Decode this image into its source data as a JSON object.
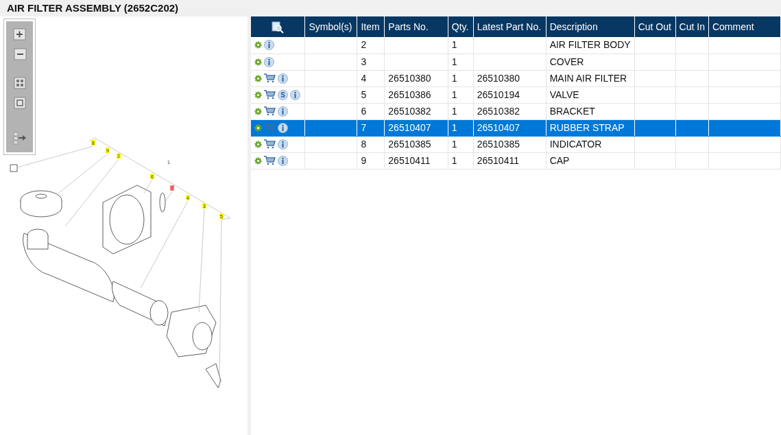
{
  "title": "AIR FILTER ASSEMBLY (2652C202)",
  "diagram": {
    "callouts": [
      {
        "label": "8",
        "kind": "tag",
        "selected": false
      },
      {
        "label": "9",
        "kind": "tag",
        "selected": false
      },
      {
        "label": "2",
        "kind": "tag",
        "selected": false
      },
      {
        "label": "1",
        "kind": "plain",
        "selected": false
      },
      {
        "label": "6",
        "kind": "tag",
        "selected": false
      },
      {
        "label": "7",
        "kind": "tag",
        "selected": true
      },
      {
        "label": "4",
        "kind": "tag",
        "selected": false
      },
      {
        "label": "3",
        "kind": "tag",
        "selected": false
      },
      {
        "label": "5",
        "kind": "tag",
        "selected": false
      }
    ]
  },
  "table": {
    "columns": [
      "Symbol(s)",
      "Item",
      "Parts No.",
      "Qty.",
      "Latest Part No.",
      "Description",
      "Cut Out",
      "Cut In",
      "Comment"
    ],
    "rows": [
      {
        "icons": [
          {
            "kind": "gear"
          },
          {
            "kind": "info"
          }
        ],
        "cells": [
          "",
          "2",
          "",
          "1",
          "",
          "AIR FILTER BODY",
          "",
          "",
          ""
        ],
        "selected": false
      },
      {
        "icons": [
          {
            "kind": "gear"
          },
          {
            "kind": "info"
          }
        ],
        "cells": [
          "",
          "3",
          "",
          "1",
          "",
          "COVER",
          "",
          "",
          ""
        ],
        "selected": false
      },
      {
        "icons": [
          {
            "kind": "gear"
          },
          {
            "kind": "cart"
          },
          {
            "kind": "info"
          }
        ],
        "cells": [
          "",
          "4",
          "26510380",
          "1",
          "26510380",
          "MAIN AIR FILTER",
          "",
          "",
          ""
        ],
        "selected": false
      },
      {
        "icons": [
          {
            "kind": "gear"
          },
          {
            "kind": "cart"
          },
          {
            "kind": "letter",
            "text": "S"
          },
          {
            "kind": "info"
          }
        ],
        "cells": [
          "",
          "5",
          "26510386",
          "1",
          "26510194",
          "VALVE",
          "",
          "",
          ""
        ],
        "selected": false
      },
      {
        "icons": [
          {
            "kind": "gear"
          },
          {
            "kind": "cart"
          },
          {
            "kind": "info"
          }
        ],
        "cells": [
          "",
          "6",
          "26510382",
          "1",
          "26510382",
          "BRACKET",
          "",
          "",
          ""
        ],
        "selected": false
      },
      {
        "icons": [
          {
            "kind": "gear"
          },
          {
            "kind": "cart"
          },
          {
            "kind": "info"
          }
        ],
        "cells": [
          "",
          "7",
          "26510407",
          "1",
          "26510407",
          "RUBBER STRAP",
          "",
          "",
          ""
        ],
        "selected": true
      },
      {
        "icons": [
          {
            "kind": "gear"
          },
          {
            "kind": "cart"
          },
          {
            "kind": "info"
          }
        ],
        "cells": [
          "",
          "8",
          "26510385",
          "1",
          "26510385",
          "INDICATOR",
          "",
          "",
          ""
        ],
        "selected": false
      },
      {
        "icons": [
          {
            "kind": "gear"
          },
          {
            "kind": "cart"
          },
          {
            "kind": "info"
          }
        ],
        "cells": [
          "",
          "9",
          "26510411",
          "1",
          "26510411",
          "CAP",
          "",
          "",
          ""
        ],
        "selected": false
      }
    ]
  }
}
